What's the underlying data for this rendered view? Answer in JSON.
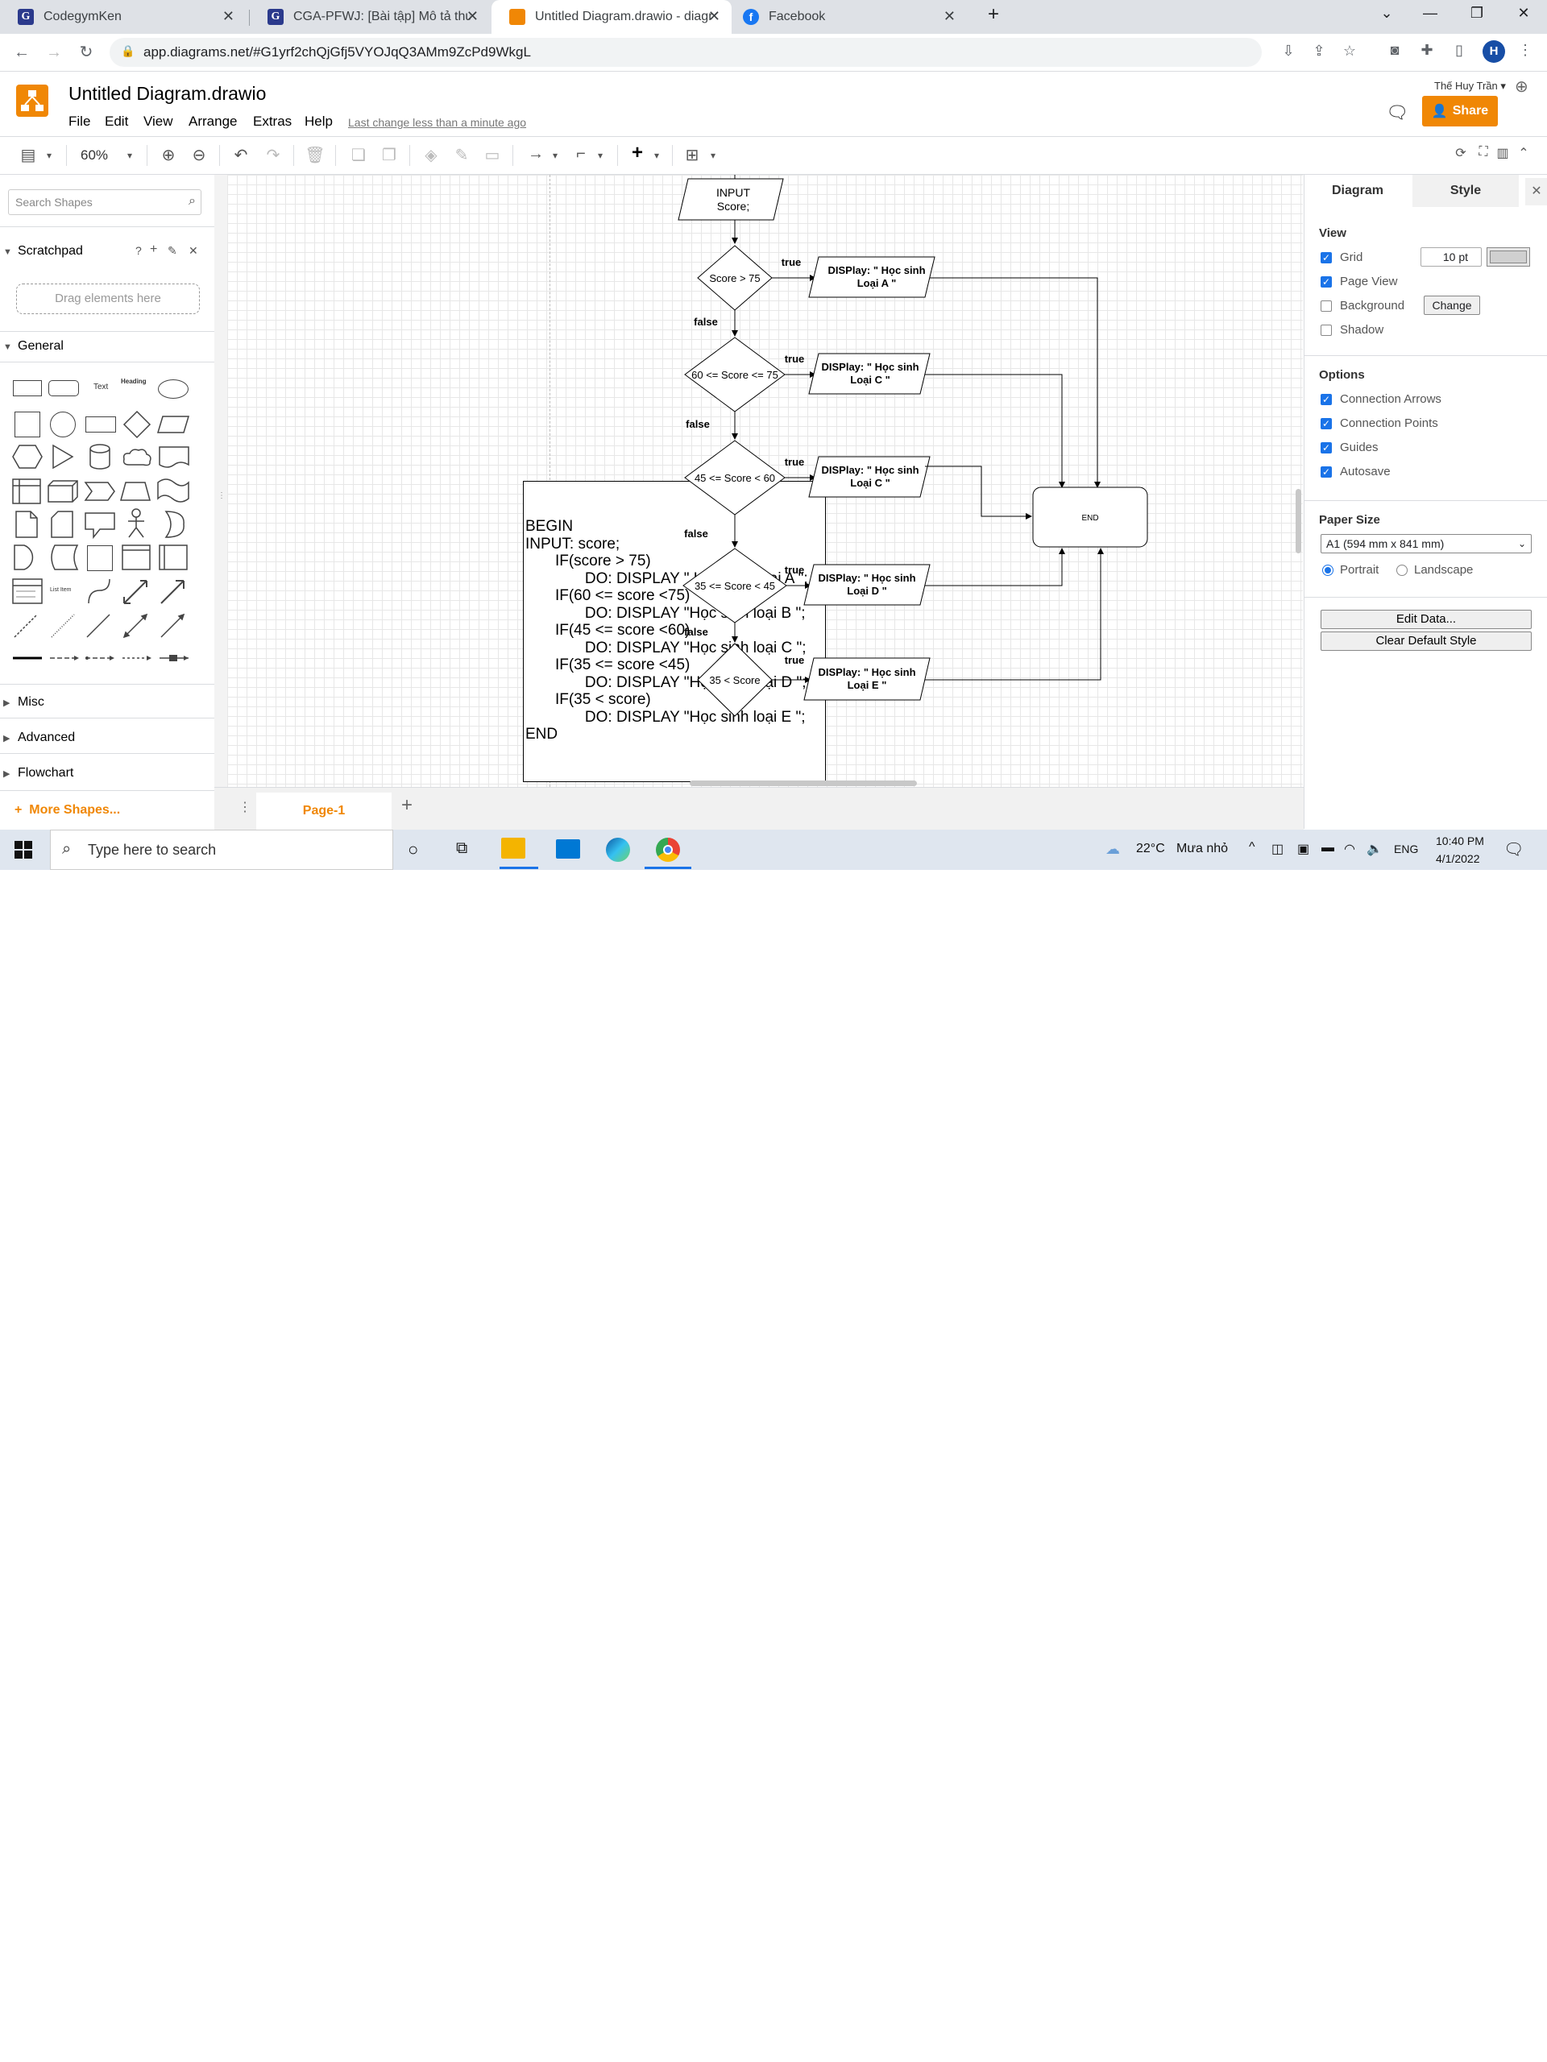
{
  "browser": {
    "tabs": [
      {
        "label": "CodegymKen",
        "favicon_color": "#2b3a8c",
        "favicon_letter": "G"
      },
      {
        "label": "CGA-PFWJ: [Bài tập] Mô tả thuật",
        "favicon_color": "#2b3a8c",
        "favicon_letter": "G"
      },
      {
        "label": "Untitled Diagram.drawio - diagra",
        "favicon_color": "#f08705",
        "favicon_letter": ""
      },
      {
        "label": "Facebook",
        "favicon_color": "#1877f2",
        "favicon_letter": "f"
      }
    ],
    "new_tab": "+",
    "url": "app.diagrams.net/#G1yrf2chQjGfj5VYOJqQ3AMm9ZcPd9WkgL",
    "profile_letter": "H"
  },
  "app": {
    "title": "Untitled Diagram.drawio",
    "menus": [
      "File",
      "Edit",
      "View",
      "Arrange",
      "Extras",
      "Help"
    ],
    "last_change": "Last change less than a minute ago",
    "user": "Thế Huy Trần",
    "share_label": "Share",
    "zoom": "60%",
    "accent_color": "#f08705"
  },
  "left_panel": {
    "search_placeholder": "Search Shapes",
    "scratchpad": "Scratchpad",
    "scratchpad_help": "?",
    "drag_here": "Drag elements here",
    "general": "General",
    "sections": [
      "Misc",
      "Advanced",
      "Flowchart"
    ],
    "more_shapes": "More Shapes...",
    "text_shape": "Text",
    "heading_shape": "Heading",
    "list_item_shape": "List Item"
  },
  "pseudocode": [
    "BEGIN",
    "INPUT: score;",
    "       IF(score > 75)",
    "              DO: DISPLAY \" Học sinh loại A \";",
    "       IF(60 <= score <75)",
    "              DO: DISPLAY \"Học sinh loại B \";",
    "       IF(45 <= score <60)",
    "              DO: DISPLAY \"Học sinh loại C \";",
    "       IF(35 <= score <45)",
    "              DO: DISPLAY \"Học sinh loại D \";",
    "       IF(35 < score)",
    "              DO: DISPLAY \"Học sinh loại E \";",
    "END"
  ],
  "flowchart": {
    "input_line1": "INPUT",
    "input_line2": "Score;",
    "decisions": [
      "Score > 75",
      "60 <= Score <= 75",
      "45 <= Score < 60",
      "35 <= Score < 45",
      "35 < Score"
    ],
    "outputs": [
      [
        "DISPlay: \" Học sinh",
        "Loại A \""
      ],
      [
        "DISPlay: \" Học sinh",
        "Loại C \""
      ],
      [
        "DISPlay: \" Học sinh",
        "Loại C \""
      ],
      [
        "DISPlay: \" Học sinh",
        "Loại D \""
      ],
      [
        "DISPlay: \" Học sinh",
        "Loại E \""
      ]
    ],
    "true_label": "true",
    "false_label": "false",
    "end_label": "END"
  },
  "page_tab": "Page-1",
  "right_panel": {
    "tabs": [
      "Diagram",
      "Style"
    ],
    "view_header": "View",
    "view_options": [
      {
        "label": "Grid",
        "checked": true
      },
      {
        "label": "Page View",
        "checked": true
      },
      {
        "label": "Background",
        "checked": false
      },
      {
        "label": "Shadow",
        "checked": false
      }
    ],
    "grid_size": "10 pt",
    "change_label": "Change",
    "options_header": "Options",
    "options": [
      {
        "label": "Connection Arrows",
        "checked": true
      },
      {
        "label": "Connection Points",
        "checked": true
      },
      {
        "label": "Guides",
        "checked": true
      },
      {
        "label": "Autosave",
        "checked": true
      }
    ],
    "paper_size_header": "Paper Size",
    "paper_size": "A1 (594 mm x 841 mm)",
    "portrait": "Portrait",
    "landscape": "Landscape",
    "edit_data": "Edit Data...",
    "clear_style": "Clear Default Style"
  },
  "taskbar": {
    "search_placeholder": "Type here to search",
    "weather_temp": "22°C",
    "weather_text": "Mưa nhỏ",
    "lang": "ENG",
    "time": "10:40 PM",
    "date": "4/1/2022"
  }
}
